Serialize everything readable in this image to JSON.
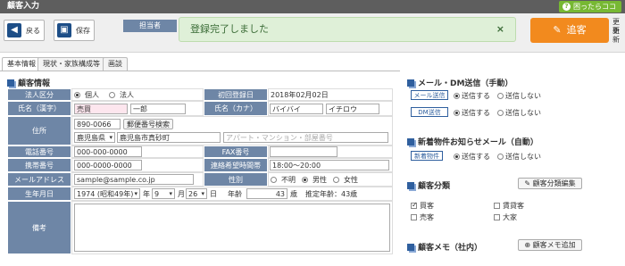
{
  "app": {
    "title": "顧客入力",
    "help_label": "困ったらココ"
  },
  "toolbar": {
    "back_label": "戻る",
    "save_label": "保存",
    "tanto_label": "担当者",
    "toast_message": "登録完了しました",
    "toast_close": "×",
    "register_label": "追客",
    "updated_1": "更新",
    "updated_2": "更新"
  },
  "tabs": [
    "基本情報",
    "現状・家族構成等",
    "画談"
  ],
  "customer": {
    "section_title": "顧客情報",
    "labels": {
      "kubun": "法人区分",
      "first_reg": "初回登録日",
      "name_kanji": "氏名（漢字）",
      "name_kana": "氏名（カナ）",
      "address": "住所",
      "tel": "電話番号",
      "fax": "FAX番号",
      "mobile": "携帯番号",
      "contact_time": "連絡希望時間帯",
      "email": "メールアドレス",
      "gender": "性別",
      "birthday": "生年月日",
      "notes": "備考"
    },
    "kubun_options": [
      "個人",
      "法人"
    ],
    "first_reg_value": "2018年02月02日",
    "last_name": "売買",
    "first_name": "一郎",
    "last_kana": "バイバイ",
    "first_kana": "イチロウ",
    "zip": "890-0066",
    "zip_search_label": "郵便番号検索",
    "prefecture": "鹿児島県",
    "city": "鹿児島市真砂町",
    "building_placeholder": "アパート・マンション・部屋番号",
    "tel_value": "000-000-0000",
    "mobile_value": "000-0000-0000",
    "contact_time_value": "18:00～20:00",
    "email_value": "sample@sample.co.jp",
    "gender_options": [
      "不明",
      "男性",
      "女性"
    ],
    "birth_year": "1974 (昭和49年)",
    "year_suffix": "年",
    "birth_month": "9",
    "month_suffix": "月",
    "birth_day": "26",
    "day_suffix": "日",
    "age_label": "年齢",
    "age_value": "43",
    "age_unit": "歳",
    "est_age": "推定年齢：43歳"
  },
  "mail_dm": {
    "title": "メール・DM送信（手動）",
    "rows": [
      {
        "label": "メール送信",
        "on": "送信する",
        "off": "送信しない"
      },
      {
        "label": "DM送信",
        "on": "送信する",
        "off": "送信しない"
      }
    ]
  },
  "new_property": {
    "title": "新着物件お知らせメール（自動）",
    "label": "新着物件",
    "on": "送信する",
    "off": "送信しない"
  },
  "category": {
    "title": "顧客分類",
    "edit_label": "顧客分類編集",
    "items": [
      "買客",
      "賃貸客",
      "売客",
      "大家"
    ]
  },
  "memo": {
    "title": "顧客メモ（社内）",
    "add_label": "顧客メモ追加"
  }
}
